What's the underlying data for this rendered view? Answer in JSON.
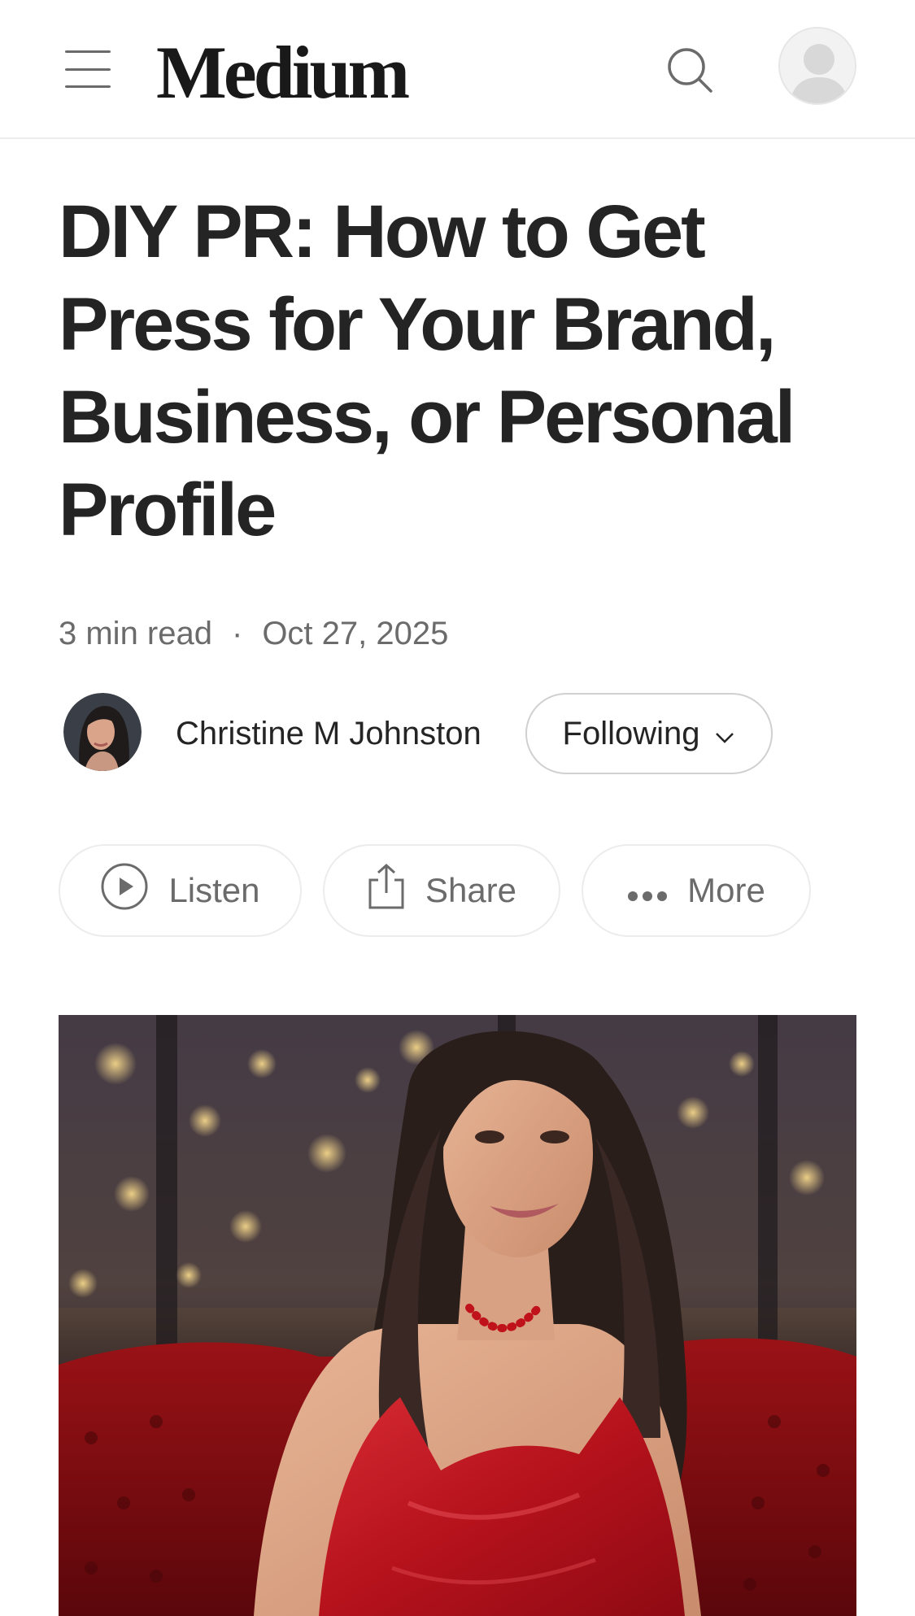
{
  "header": {
    "logo_text": "Medium",
    "menu_icon": "hamburger-menu-icon",
    "search_icon": "search-icon",
    "profile_icon": "user-avatar-icon"
  },
  "article": {
    "title": "DIY PR: How to Get Press for Your Brand, Business, or Personal Profile",
    "read_time": "3 min read",
    "separator": "·",
    "date": "Oct 27, 2025"
  },
  "author": {
    "name": "Christine M Johnston",
    "follow_label": "Following"
  },
  "actions": {
    "listen_label": "Listen",
    "share_label": "Share",
    "more_label": "More"
  },
  "colors": {
    "text_primary": "#242424",
    "text_secondary": "#6b6b6b",
    "border": "#ececec"
  }
}
